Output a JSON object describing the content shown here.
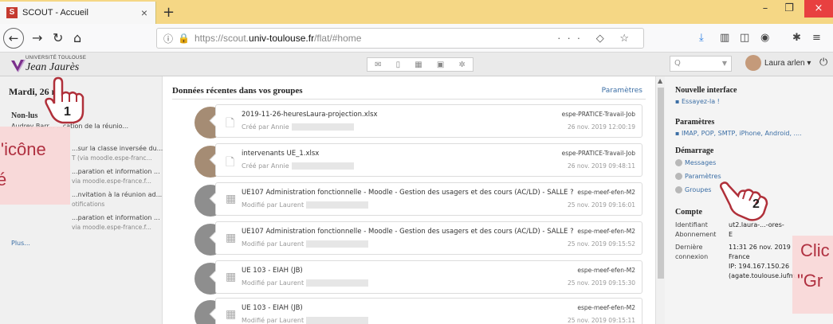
{
  "browser": {
    "tab_title": "SCOUT - Accueil",
    "tab_favicon": "S",
    "new_tab": "+",
    "url_prefix": "https://scout.",
    "url_host": "univ-toulouse.fr",
    "url_path": "/flat/#home",
    "url_icons": "··· ◇ ☆",
    "close_symbol": "×",
    "minimize_symbol": "–",
    "maximize_symbol": "❐"
  },
  "app": {
    "logo_top": "UNIVERSITÉ TOULOUSE",
    "logo_main": "Jean Jaurès",
    "search_placeholder": "Q",
    "user_name": "Laura arlen ▾",
    "toolbar_icons": [
      "✉",
      "▯",
      "▦",
      "▣",
      "✲"
    ]
  },
  "left": {
    "date": "Mardi, 26 n",
    "section": "Non-lus",
    "items": [
      {
        "text": "Audrey Barr...   ...cation de la réunio...",
        "sub": ""
      },
      {
        "text": "...sur la classe inversée du...",
        "sub": "T (via moodle.espe-franc..."
      },
      {
        "text": "...paration et information ...",
        "sub": "via moodle.espe-france.f..."
      },
      {
        "text": "...nvitation à la réunion ad...",
        "sub": "otifications"
      },
      {
        "text": "...paration et information ...",
        "sub": "via moodle.espe-france.f..."
      }
    ],
    "plus": "Plus..."
  },
  "main": {
    "title": "Données récentes dans vos groupes",
    "params": "Paramètres",
    "feed": [
      {
        "name": "2019-11-26-heuresLaura-projection.xlsx",
        "by": "Créé par Annie",
        "group": "espe-PRATICE-Travail-Job",
        "date": "26 nov. 2019 12:00:19",
        "icon": "file-icon"
      },
      {
        "name": "intervenants UE_1.xlsx",
        "by": "Créé par Annie",
        "group": "espe-PRATICE-Travail-Job",
        "date": "26 nov. 2019 09:48:11",
        "icon": "file-icon"
      },
      {
        "name": "UE107 Administration fonctionnelle - Moodle - Gestion des usagers et des cours (AC/LD) - SALLE ?",
        "by": "Modifié par Laurent",
        "group": "espe-meef-efen-M2",
        "date": "25 nov. 2019 09:16:01",
        "icon": "calendar-icon"
      },
      {
        "name": "UE107 Administration fonctionnelle - Moodle - Gestion des usagers et des cours (AC/LD) - SALLE ?",
        "by": "Modifié par Laurent",
        "group": "espe-meef-efen-M2",
        "date": "25 nov. 2019 09:15:52",
        "icon": "calendar-icon"
      },
      {
        "name": "UE 103 - EIAH (JB)",
        "by": "Modifié par Laurent",
        "group": "espe-meef-efen-M2",
        "date": "25 nov. 2019 09:15:30",
        "icon": "calendar-icon"
      },
      {
        "name": "UE 103 - EIAH (JB)",
        "by": "Modifié par Laurent",
        "group": "espe-meef-efen-M2",
        "date": "25 nov. 2019 09:15:11",
        "icon": "calendar-icon"
      }
    ]
  },
  "right": {
    "new_interface": "Nouvelle interface",
    "try_it": "Essayez-la !",
    "params_title": "Paramètres",
    "params_link": "IMAP, POP, SMTP, iPhone, Android, ....",
    "start_title": "Démarrage",
    "start_links": [
      "Messages",
      "Paramètres",
      "Groupes"
    ],
    "account_title": "Compte",
    "account": [
      {
        "label": "Identifiant",
        "value": "ut2.laura-...-ores-"
      },
      {
        "label": "Abonnement",
        "value": "E"
      },
      {
        "label": "Dernière",
        "value": "11:31 26 nov. 2019"
      },
      {
        "label": "connexion",
        "value": "France"
      },
      {
        "label": "",
        "value": "IP: 194.167.150.26"
      },
      {
        "label": "",
        "value": "(agate.toulouse.iufm."
      }
    ]
  },
  "overlays": {
    "left_line1": "l'icône",
    "left_line2": "é",
    "right_line1": "Clic",
    "right_line2": "\"Gr",
    "step1": "1",
    "step2": "2"
  }
}
